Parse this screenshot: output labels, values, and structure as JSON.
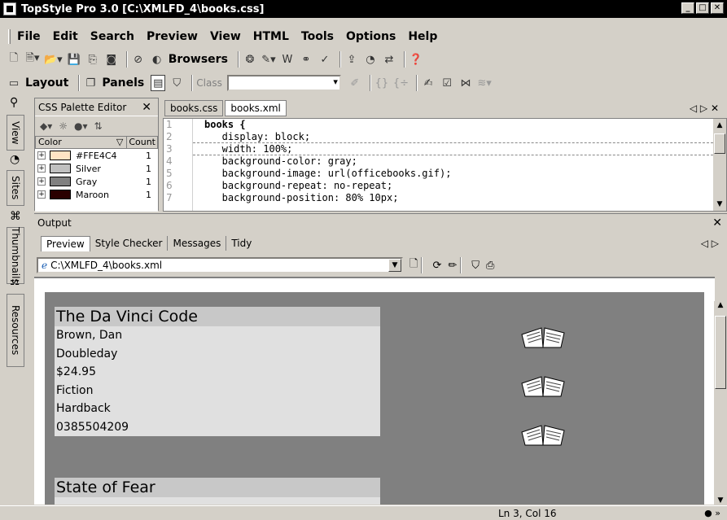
{
  "window": {
    "title": "TopStyle Pro 3.0  [C:\\XMLFD_4\\books.css]"
  },
  "menu": [
    "File",
    "Edit",
    "Search",
    "Preview",
    "View",
    "HTML",
    "Tools",
    "Options",
    "Help"
  ],
  "toolbar": {
    "browsers_label": "Browsers",
    "layout_label": "Layout",
    "panels_label": "Panels",
    "class_label": "Class"
  },
  "side_tabs": [
    "View",
    "Sites",
    "Thumbnails",
    "Resources"
  ],
  "palette": {
    "title": "CSS Palette Editor",
    "close": "✕",
    "col_color": "Color",
    "col_count": "Count",
    "items": [
      {
        "name": "#FFE4C4",
        "count": "1",
        "color": "#FFE4C4"
      },
      {
        "name": "Silver",
        "count": "1",
        "color": "#C0C0C0"
      },
      {
        "name": "Gray",
        "count": "1",
        "color": "#808080"
      },
      {
        "name": "Maroon",
        "count": "1",
        "color": "#2a0000"
      }
    ]
  },
  "editor": {
    "tabs": [
      "books.css",
      "books.xml"
    ],
    "line_numbers": [
      "1",
      "2",
      "3",
      "4",
      "5",
      "6",
      "7"
    ],
    "lines": [
      "books {",
      "   display: block;",
      "   width: 100%;",
      "   background-color: gray;",
      "   background-image: url(officebooks.gif);",
      "   background-repeat: no-repeat;",
      "   background-position: 80% 10px;"
    ]
  },
  "output": {
    "title": "Output",
    "close": "✕",
    "tabs": [
      "Preview",
      "Style Checker",
      "Messages",
      "Tidy"
    ],
    "url": "C:\\XMLFD_4\\books.xml"
  },
  "books": [
    {
      "title": "The Da Vinci Code",
      "fields": [
        "Brown, Dan",
        "Doubleday",
        "$24.95",
        "Fiction",
        "Hardback",
        "0385504209"
      ]
    },
    {
      "title": "State of Fear",
      "fields": []
    }
  ],
  "status": {
    "position": "Ln 3, Col 16",
    "right": "● »"
  }
}
